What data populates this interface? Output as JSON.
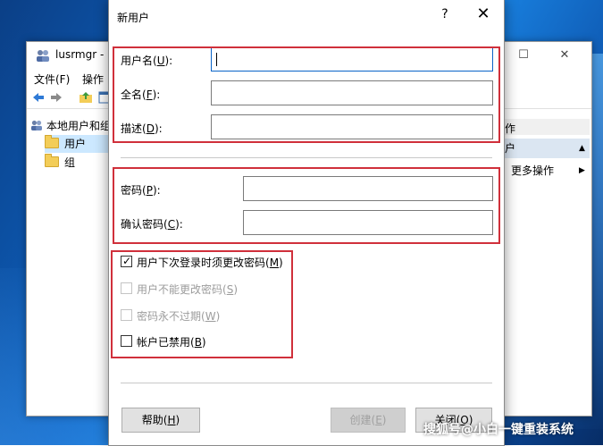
{
  "background_window": {
    "title": "lusrmgr - [",
    "menu": [
      "文件(F)",
      "操作"
    ],
    "tree": {
      "root": "本地用户和组",
      "items": [
        "用户",
        "组"
      ]
    },
    "actions": {
      "header": "作",
      "sub": "户",
      "more": "更多操作"
    }
  },
  "dialog": {
    "title": "新用户",
    "help_glyph": "?",
    "close_glyph": "✕",
    "fields": {
      "username": {
        "label": "用户名(",
        "key": "U",
        "suffix": "):",
        "value": ""
      },
      "fullname": {
        "label": "全名(",
        "key": "F",
        "suffix": "):",
        "value": ""
      },
      "description": {
        "label": "描述(",
        "key": "D",
        "suffix": "):",
        "value": ""
      },
      "password": {
        "label": "密码(",
        "key": "P",
        "suffix": "):",
        "value": ""
      },
      "confirm": {
        "label": "确认密码(",
        "key": "C",
        "suffix": "):",
        "value": ""
      }
    },
    "checkboxes": [
      {
        "label": "用户下次登录时须更改密码(",
        "key": "M",
        "suffix": ")",
        "checked": true,
        "enabled": true
      },
      {
        "label": "用户不能更改密码(",
        "key": "S",
        "suffix": ")",
        "checked": false,
        "enabled": false
      },
      {
        "label": "密码永不过期(",
        "key": "W",
        "suffix": ")",
        "checked": false,
        "enabled": false
      },
      {
        "label": "帐户已禁用(",
        "key": "B",
        "suffix": ")",
        "checked": false,
        "enabled": true
      }
    ],
    "buttons": {
      "help": {
        "label": "帮助(",
        "key": "H",
        "suffix": ")"
      },
      "create": {
        "label": "创建(",
        "key": "E",
        "suffix": ")"
      },
      "close": {
        "label": "关闭(",
        "key": "O",
        "suffix": ")"
      }
    },
    "highlight_color": "#d0303b"
  },
  "watermark": "搜狐号@小白一键重装系统"
}
